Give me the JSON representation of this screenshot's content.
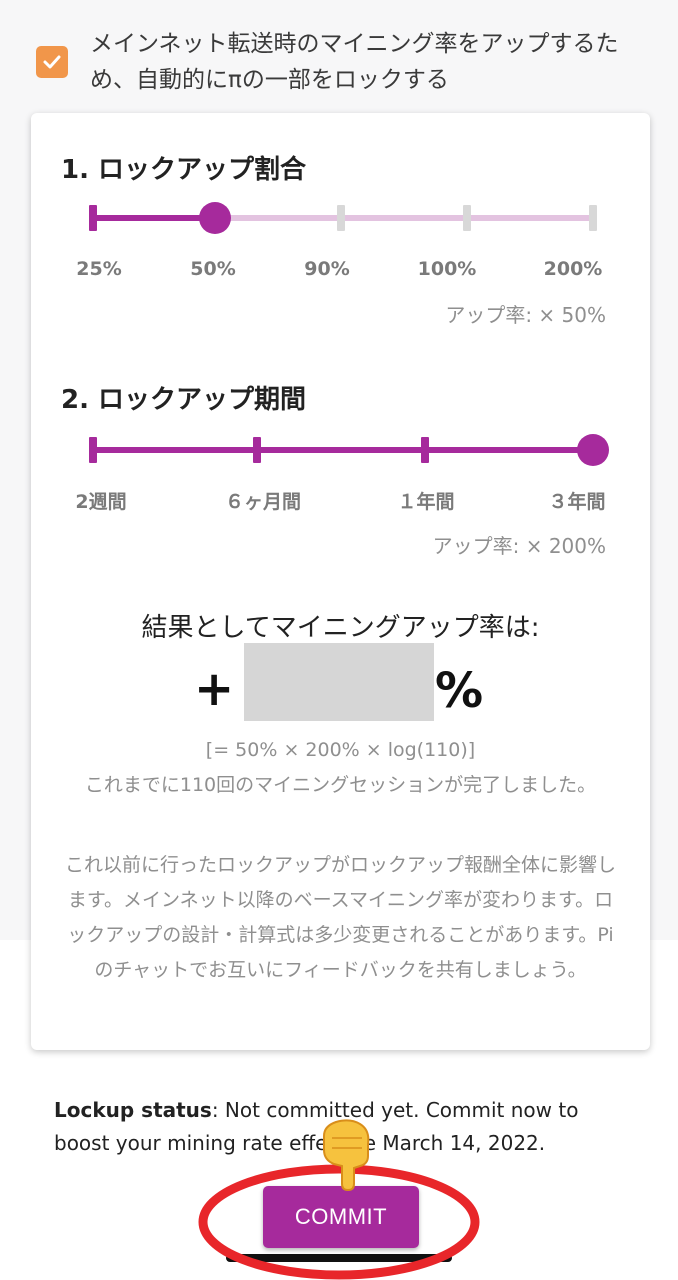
{
  "option": {
    "checked": true,
    "label": "メインネット転送時のマイニング率をアップするため、自動的にπの一部をロックする"
  },
  "ratio": {
    "title": "1. ロックアップ割合",
    "options": [
      "25%",
      "50%",
      "90%",
      "100%",
      "200%"
    ],
    "selected_index": 1,
    "rate_text": "アップ率: × 50%"
  },
  "period": {
    "title": "2. ロックアップ期間",
    "options": [
      "2週間",
      "６ヶ月間",
      "１年間",
      "３年間"
    ],
    "selected_index": 3,
    "rate_text": "アップ率: × 200%"
  },
  "result": {
    "heading": "結果としてマイニングアップ率は:",
    "plus_sign": "+",
    "percent_sign": "%",
    "formula": "[= 50% × 200% × log(110)]",
    "sessions": "これまでに110回のマイニングセッションが完了しました。",
    "disclaimer": "これ以前に行ったロックアップがロックアップ報酬全体に影響します。メインネット以降のベースマイニング率が変わります。ロックアップの設計・計算式は多少変更されることがあります。Piのチャットでお互いにフィードバックを共有しましょう。"
  },
  "status": {
    "label": "Lockup status",
    "text": ": Not committed yet. Commit now to boost your mining rate effective March 14, 2022."
  },
  "commit_label": "COMMIT",
  "colors": {
    "accent": "#a62a9c",
    "accent_light": "#e3c3e0",
    "checkbox": "#f1964a",
    "annotation": "#e8262a"
  }
}
